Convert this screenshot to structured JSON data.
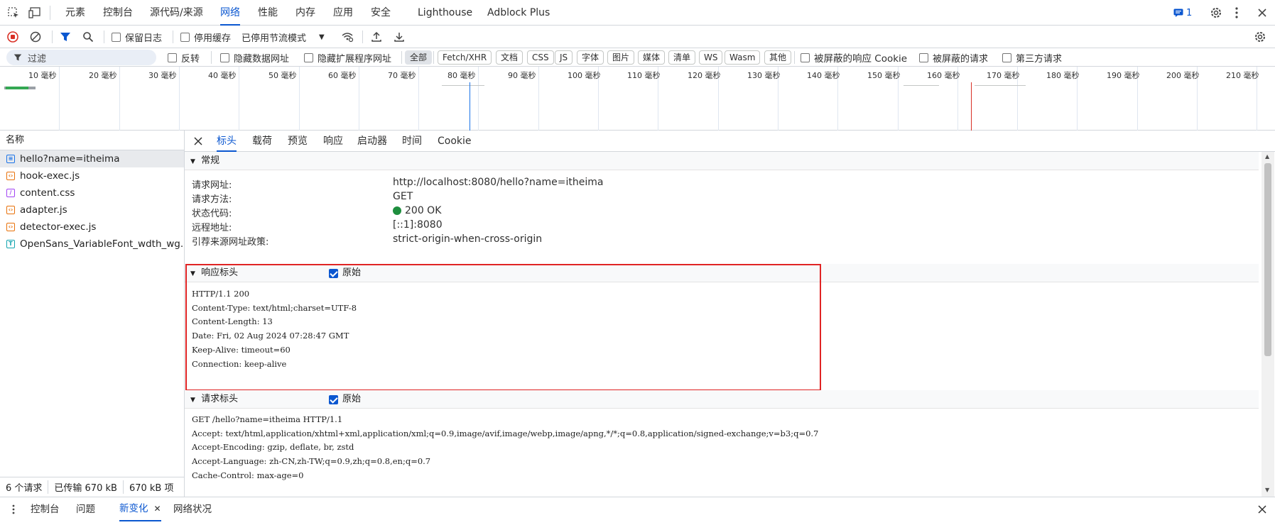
{
  "toptabs": {
    "elements": "元素",
    "console": "控制台",
    "sources": "源代码/来源",
    "network": "网络",
    "performance": "性能",
    "memory": "内存",
    "application": "应用",
    "security": "安全",
    "lighthouse": "Lighthouse",
    "adblock": "Adblock Plus",
    "issues_count": "1"
  },
  "toolbar": {
    "preserve_log": "保留日志",
    "disable_cache": "停用缓存",
    "throttling": "已停用节流模式"
  },
  "filter": {
    "placeholder": "过滤",
    "invert": "反转",
    "hide_data_urls": "隐藏数据网址",
    "hide_ext_urls": "隐藏扩展程序网址",
    "types": [
      "全部",
      "Fetch/XHR",
      "文档",
      "CSS",
      "JS",
      "字体",
      "图片",
      "媒体",
      "清单",
      "WS",
      "Wasm",
      "其他"
    ],
    "blocked_cookies": "被屏蔽的响应 Cookie",
    "blocked_requests": "被屏蔽的请求",
    "third_party": "第三方请求"
  },
  "timeline": {
    "ticks": [
      "10 毫秒",
      "20 毫秒",
      "30 毫秒",
      "40 毫秒",
      "50 毫秒",
      "60 毫秒",
      "70 毫秒",
      "80 毫秒",
      "90 毫秒",
      "100 毫秒",
      "110 毫秒",
      "120 毫秒",
      "130 毫秒",
      "140 毫秒",
      "150 毫秒",
      "160 毫秒",
      "170 毫秒",
      "180 毫秒",
      "190 毫秒",
      "200 毫秒",
      "210 毫秒"
    ]
  },
  "requests": {
    "header": "名称",
    "items": [
      {
        "name": "hello?name=itheima",
        "icon": "document-icon",
        "color": "#1a73e8"
      },
      {
        "name": "hook-exec.js",
        "icon": "script-icon",
        "color": "#e8710a"
      },
      {
        "name": "content.css",
        "icon": "stylesheet-icon",
        "color": "#a142f4"
      },
      {
        "name": "adapter.js",
        "icon": "script-icon",
        "color": "#e8710a"
      },
      {
        "name": "detector-exec.js",
        "icon": "script-icon",
        "color": "#e8710a"
      },
      {
        "name": "OpenSans_VariableFont_wdth_wg...",
        "icon": "font-icon",
        "color": "#12a4af"
      }
    ],
    "footer": {
      "count": "6 个请求",
      "transferred": "已传输 670 kB",
      "resources": "670 kB 项"
    }
  },
  "detail_tabs": [
    "标头",
    "载荷",
    "预览",
    "响应",
    "启动器",
    "时间",
    "Cookie"
  ],
  "general": {
    "title": "常规",
    "rows": [
      {
        "k": "请求网址:",
        "v": "http://localhost:8080/hello?name=itheima"
      },
      {
        "k": "请求方法:",
        "v": "GET"
      },
      {
        "k": "状态代码:",
        "v": "200 OK"
      },
      {
        "k": "远程地址:",
        "v": "[::1]:8080"
      },
      {
        "k": "引荐来源网址政策:",
        "v": "strict-origin-when-cross-origin"
      }
    ]
  },
  "response_headers": {
    "title": "响应标头",
    "raw_label": "原始",
    "lines": [
      "HTTP/1.1 200",
      "Content-Type: text/html;charset=UTF-8",
      "Content-Length: 13",
      "Date: Fri, 02 Aug 2024 07:28:47 GMT",
      "Keep-Alive: timeout=60",
      "Connection: keep-alive"
    ]
  },
  "request_headers": {
    "title": "请求标头",
    "raw_label": "原始",
    "lines": [
      "GET /hello?name=itheima HTTP/1.1",
      "Accept: text/html,application/xhtml+xml,application/xml;q=0.9,image/avif,image/webp,image/apng,*/*;q=0.8,application/signed-exchange;v=b3;q=0.7",
      "Accept-Encoding: gzip, deflate, br, zstd",
      "Accept-Language: zh-CN,zh-TW;q=0.9,zh;q=0.8,en;q=0.7",
      "Cache-Control: max-age=0"
    ]
  },
  "drawer": {
    "console": "控制台",
    "issues": "问题",
    "changes": "新变化",
    "network_conditions": "网络状况"
  },
  "colors": {
    "accent": "#0b57d0",
    "highlight_box": "#e02424",
    "status_ok": "#1e8e3e"
  }
}
